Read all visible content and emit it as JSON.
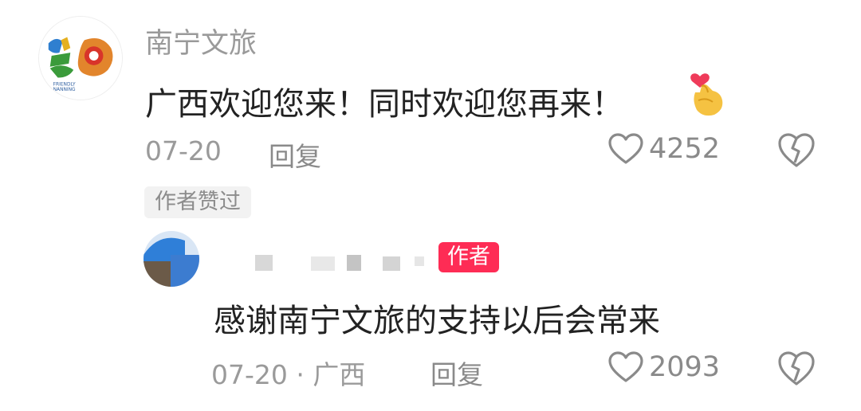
{
  "comment": {
    "author": "南宁文旅",
    "avatar_icon": "nanning-tourism-logo",
    "text": "广西欢迎您来！同时欢迎您再来！",
    "date": "07-20",
    "reply_label": "回复",
    "like_count": "4252",
    "author_liked_badge": "作者赞过"
  },
  "reply": {
    "author_tag": "作者",
    "text": "感谢南宁文旅的支持以后会常来",
    "date": "07-20 · 广西",
    "reply_label": "回复",
    "like_count": "2093"
  },
  "colors": {
    "author_tag": "#fe2c55",
    "muted_text": "#9a9a9a",
    "body_text": "#222222"
  }
}
